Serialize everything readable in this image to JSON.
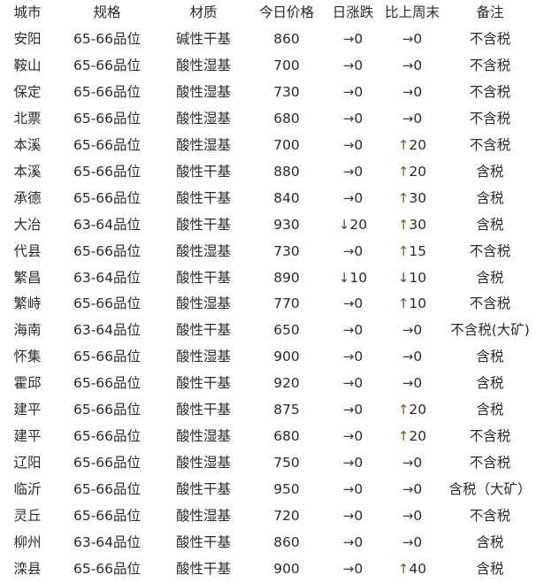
{
  "table": {
    "headers": [
      "城市",
      "规格",
      "材质",
      "今日价格",
      "日涨跌",
      "比上周末",
      "备注"
    ],
    "rows": [
      {
        "city": "安阳",
        "spec": "65-66品位",
        "material": "碱性干基",
        "price": "860",
        "daily_dir": "flat",
        "daily_arrow": "→",
        "daily_value": "0",
        "weekly_dir": "flat",
        "weekly_arrow": "→",
        "weekly_value": "0",
        "remark": "不含税"
      },
      {
        "city": "鞍山",
        "spec": "65-66品位",
        "material": "酸性湿基",
        "price": "700",
        "daily_dir": "flat",
        "daily_arrow": "→",
        "daily_value": "0",
        "weekly_dir": "flat",
        "weekly_arrow": "→",
        "weekly_value": "0",
        "remark": "不含税"
      },
      {
        "city": "保定",
        "spec": "65-66品位",
        "material": "酸性湿基",
        "price": "730",
        "daily_dir": "flat",
        "daily_arrow": "→",
        "daily_value": "0",
        "weekly_dir": "flat",
        "weekly_arrow": "→",
        "weekly_value": "0",
        "remark": "不含税"
      },
      {
        "city": "北票",
        "spec": "65-66品位",
        "material": "酸性湿基",
        "price": "680",
        "daily_dir": "flat",
        "daily_arrow": "→",
        "daily_value": "0",
        "weekly_dir": "flat",
        "weekly_arrow": "→",
        "weekly_value": "0",
        "remark": "不含税"
      },
      {
        "city": "本溪",
        "spec": "65-66品位",
        "material": "酸性湿基",
        "price": "700",
        "daily_dir": "flat",
        "daily_arrow": "→",
        "daily_value": "0",
        "weekly_dir": "up",
        "weekly_arrow": "↑",
        "weekly_value": "20",
        "remark": "不含税"
      },
      {
        "city": "本溪",
        "spec": "65-66品位",
        "material": "酸性干基",
        "price": "880",
        "daily_dir": "flat",
        "daily_arrow": "→",
        "daily_value": "0",
        "weekly_dir": "up",
        "weekly_arrow": "↑",
        "weekly_value": "20",
        "remark": "含税"
      },
      {
        "city": "承德",
        "spec": "65-66品位",
        "material": "酸性干基",
        "price": "840",
        "daily_dir": "flat",
        "daily_arrow": "→",
        "daily_value": "0",
        "weekly_dir": "up",
        "weekly_arrow": "↑",
        "weekly_value": "30",
        "remark": "含税"
      },
      {
        "city": "大冶",
        "spec": "63-64品位",
        "material": "酸性干基",
        "price": "930",
        "daily_dir": "down",
        "daily_arrow": "↓",
        "daily_value": "20",
        "weekly_dir": "up",
        "weekly_arrow": "↑",
        "weekly_value": "30",
        "remark": "含税"
      },
      {
        "city": "代县",
        "spec": "65-66品位",
        "material": "酸性湿基",
        "price": "730",
        "daily_dir": "flat",
        "daily_arrow": "→",
        "daily_value": "0",
        "weekly_dir": "up",
        "weekly_arrow": "↑",
        "weekly_value": "15",
        "remark": "不含税"
      },
      {
        "city": "繁昌",
        "spec": "63-64品位",
        "material": "酸性干基",
        "price": "890",
        "daily_dir": "down",
        "daily_arrow": "↓",
        "daily_value": "10",
        "weekly_dir": "down",
        "weekly_arrow": "↓",
        "weekly_value": "10",
        "remark": "含税"
      },
      {
        "city": "繁峙",
        "spec": "65-66品位",
        "material": "酸性湿基",
        "price": "770",
        "daily_dir": "flat",
        "daily_arrow": "→",
        "daily_value": "0",
        "weekly_dir": "up",
        "weekly_arrow": "↑",
        "weekly_value": "10",
        "remark": "不含税"
      },
      {
        "city": "海南",
        "spec": "63-64品位",
        "material": "酸性干基",
        "price": "650",
        "daily_dir": "flat",
        "daily_arrow": "→",
        "daily_value": "0",
        "weekly_dir": "flat",
        "weekly_arrow": "→",
        "weekly_value": "0",
        "remark": "不含税(大矿)"
      },
      {
        "city": "怀集",
        "spec": "65-66品位",
        "material": "酸性湿基",
        "price": "900",
        "daily_dir": "flat",
        "daily_arrow": "→",
        "daily_value": "0",
        "weekly_dir": "flat",
        "weekly_arrow": "→",
        "weekly_value": "0",
        "remark": "含税"
      },
      {
        "city": "霍邱",
        "spec": "65-66品位",
        "material": "酸性干基",
        "price": "920",
        "daily_dir": "flat",
        "daily_arrow": "→",
        "daily_value": "0",
        "weekly_dir": "flat",
        "weekly_arrow": "→",
        "weekly_value": "0",
        "remark": "含税"
      },
      {
        "city": "建平",
        "spec": "65-66品位",
        "material": "酸性干基",
        "price": "875",
        "daily_dir": "flat",
        "daily_arrow": "→",
        "daily_value": "0",
        "weekly_dir": "up",
        "weekly_arrow": "↑",
        "weekly_value": "20",
        "remark": "含税"
      },
      {
        "city": "建平",
        "spec": "65-66品位",
        "material": "酸性湿基",
        "price": "680",
        "daily_dir": "flat",
        "daily_arrow": "→",
        "daily_value": "0",
        "weekly_dir": "up",
        "weekly_arrow": "↑",
        "weekly_value": "20",
        "remark": "不含税"
      },
      {
        "city": "辽阳",
        "spec": "65-66品位",
        "material": "酸性湿基",
        "price": "750",
        "daily_dir": "flat",
        "daily_arrow": "→",
        "daily_value": "0",
        "weekly_dir": "flat",
        "weekly_arrow": "→",
        "weekly_value": "0",
        "remark": "不含税"
      },
      {
        "city": "临沂",
        "spec": "65-66品位",
        "material": "酸性干基",
        "price": "950",
        "daily_dir": "flat",
        "daily_arrow": "→",
        "daily_value": "0",
        "weekly_dir": "flat",
        "weekly_arrow": "→",
        "weekly_value": "0",
        "remark": "含税（大矿）"
      },
      {
        "city": "灵丘",
        "spec": "65-66品位",
        "material": "酸性湿基",
        "price": "720",
        "daily_dir": "flat",
        "daily_arrow": "→",
        "daily_value": "0",
        "weekly_dir": "flat",
        "weekly_arrow": "→",
        "weekly_value": "0",
        "remark": "不含税"
      },
      {
        "city": "柳州",
        "spec": "63-64品位",
        "material": "酸性干基",
        "price": "860",
        "daily_dir": "flat",
        "daily_arrow": "→",
        "daily_value": "0",
        "weekly_dir": "flat",
        "weekly_arrow": "→",
        "weekly_value": "0",
        "remark": "含税"
      },
      {
        "city": "滦县",
        "spec": "65-66品位",
        "material": "酸性干基",
        "price": "900",
        "daily_dir": "flat",
        "daily_arrow": "→",
        "daily_value": "0",
        "weekly_dir": "up",
        "weekly_arrow": "↑",
        "weekly_value": "40",
        "remark": "含税"
      }
    ]
  }
}
